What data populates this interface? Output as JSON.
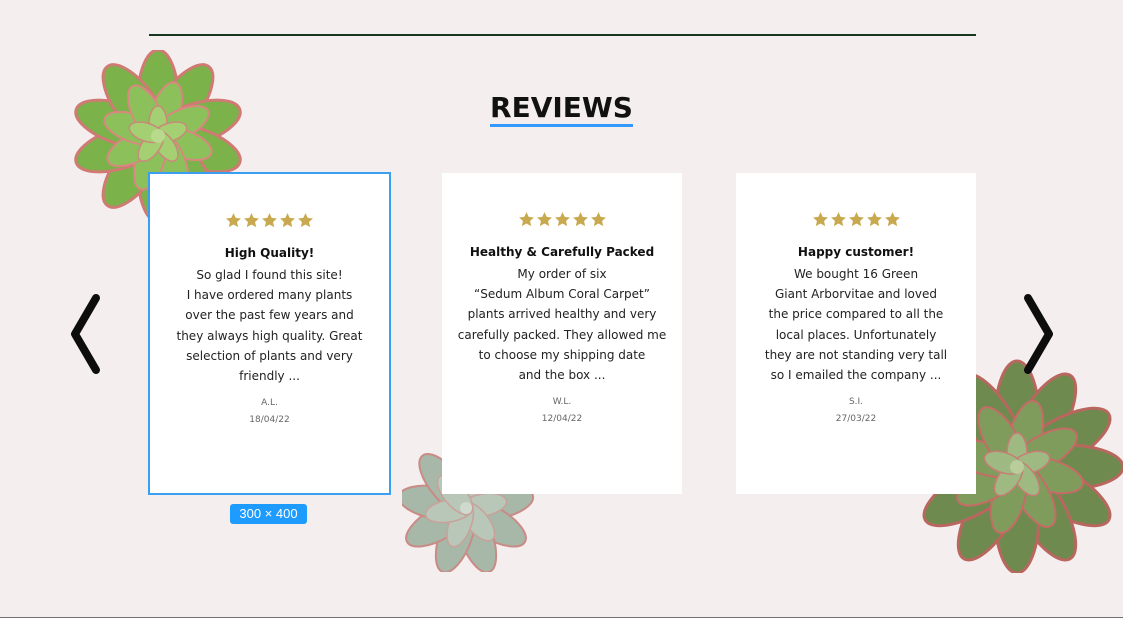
{
  "section": {
    "title": "REVIEWS"
  },
  "colors": {
    "background": "#f5eeee",
    "star": "#c9a94f",
    "selection": "#3a9ff0",
    "title_underline": "#3399ff"
  },
  "selection_badge": "300 × 400",
  "nav": {
    "prev_icon": "chevron-left-icon",
    "next_icon": "chevron-right-icon"
  },
  "reviews": [
    {
      "rating": 5,
      "title": "High Quality!",
      "lines": [
        "So glad I found this site!",
        "I have ordered many plants",
        "over the past few years and",
        "they always high quality. Great",
        "selection of plants and very",
        "friendly ..."
      ],
      "author": "A.L.",
      "date": "18/04/22"
    },
    {
      "rating": 5,
      "title": "Healthy & Carefully Packed",
      "lines": [
        "My order of six",
        "“Sedum Album Coral Carpet”",
        "plants arrived healthy and very",
        "carefully packed. They allowed me",
        "to choose my shipping date",
        "and the box ..."
      ],
      "author": "W.L.",
      "date": "12/04/22"
    },
    {
      "rating": 5,
      "title": "Happy customer!",
      "lines": [
        "We bought 16 Green",
        "Giant Arborvitae and loved",
        "the price compared to all the",
        "local places. Unfortunately",
        "they are not standing very tall",
        "so I emailed the company ..."
      ],
      "author": "S.I.",
      "date": "27/03/22"
    }
  ]
}
